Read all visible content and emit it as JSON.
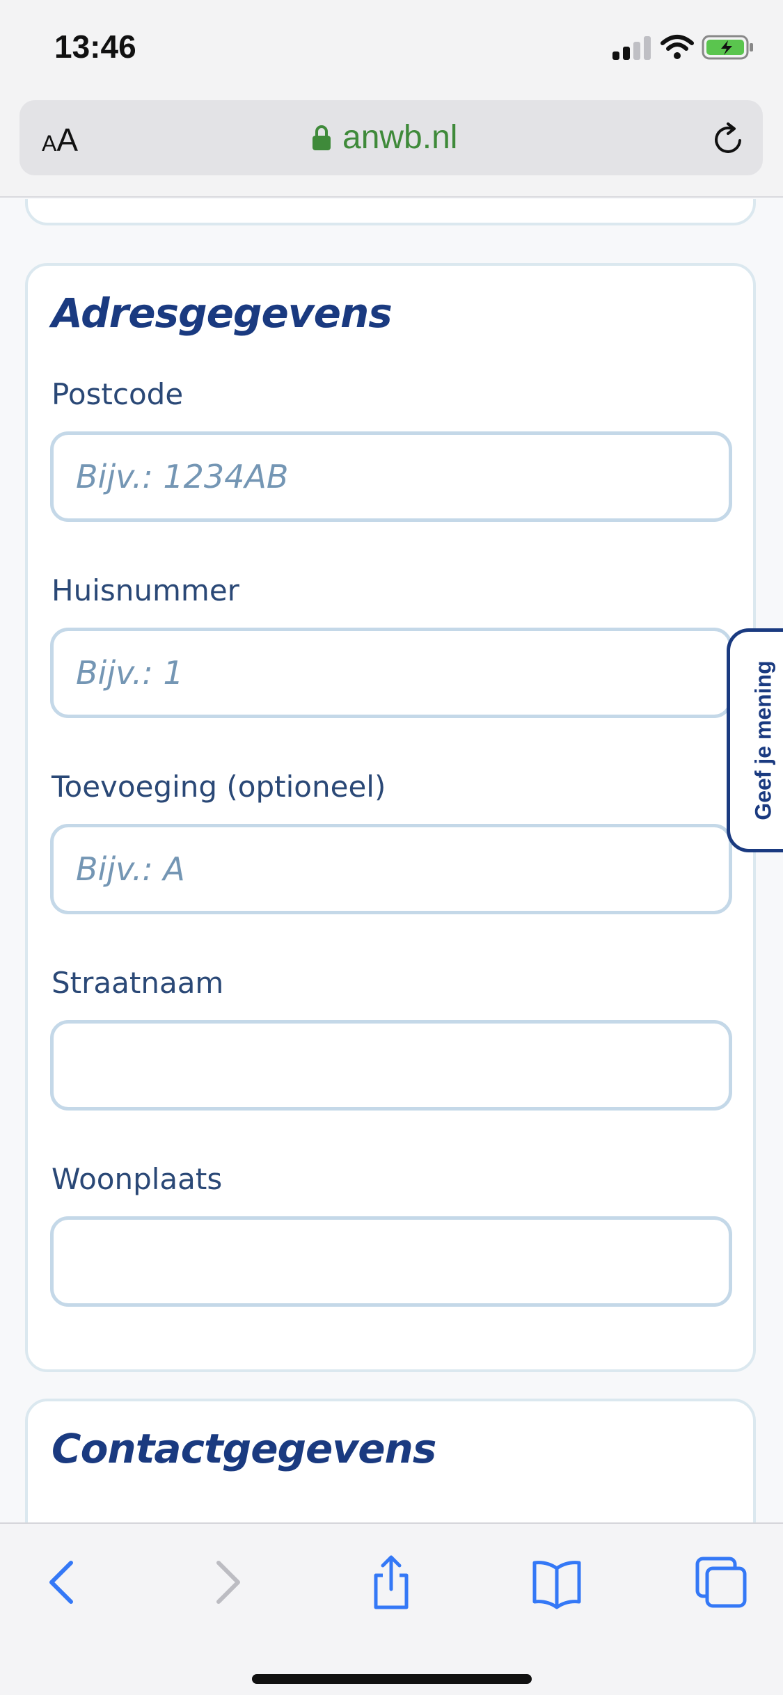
{
  "status_bar": {
    "time": "13:46"
  },
  "address_bar": {
    "text_size_label_small": "A",
    "text_size_label_large": "A",
    "url": "anwb.nl"
  },
  "address_section": {
    "title": "Adresgegevens",
    "fields": [
      {
        "label": "Postcode",
        "placeholder": "Bijv.: 1234AB",
        "value": ""
      },
      {
        "label": "Huisnummer",
        "placeholder": "Bijv.: 1",
        "value": ""
      },
      {
        "label": "Toevoeging (optioneel)",
        "placeholder": "Bijv.: A",
        "value": ""
      },
      {
        "label": "Straatnaam",
        "placeholder": "",
        "value": ""
      },
      {
        "label": "Woonplaats",
        "placeholder": "",
        "value": ""
      }
    ]
  },
  "contact_section": {
    "title": "Contactgegevens"
  },
  "feedback_tab": {
    "label": "Geef je mening"
  },
  "toolbar": {
    "icons": [
      "back-icon",
      "forward-icon",
      "share-icon",
      "bookmarks-icon",
      "tabs-icon"
    ]
  },
  "colors": {
    "accent": "#1a3a80",
    "url_green": "#3f8a3a",
    "input_border": "#c4d8e8",
    "placeholder": "#7496b4",
    "toolbar_blue": "#3478f6"
  }
}
